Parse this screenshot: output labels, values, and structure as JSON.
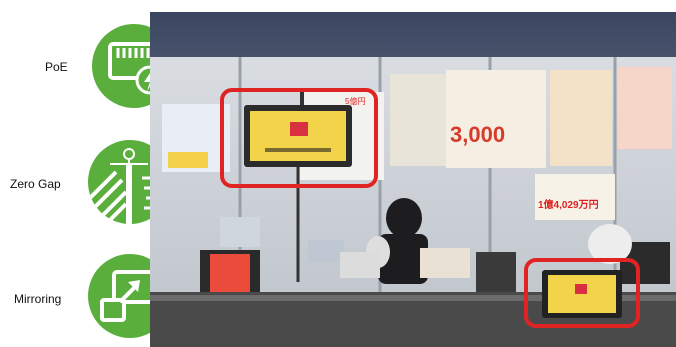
{
  "features": [
    {
      "label": "PoE",
      "icon": "ethernet-power-icon"
    },
    {
      "label": "Zero Gap",
      "icon": "zero-gap-mount-icon"
    },
    {
      "label": "Mirroring",
      "icon": "screen-mirroring-icon"
    }
  ],
  "colors": {
    "badge_green": "#5aaf3c",
    "highlight_red": "#e02424",
    "screen_yellow": "#f2d34a"
  },
  "photo": {
    "scene": "lottery-ticket-counter-photo",
    "poster_texts": [
      "3,000",
      "1億4,029万円",
      "5億円"
    ]
  }
}
